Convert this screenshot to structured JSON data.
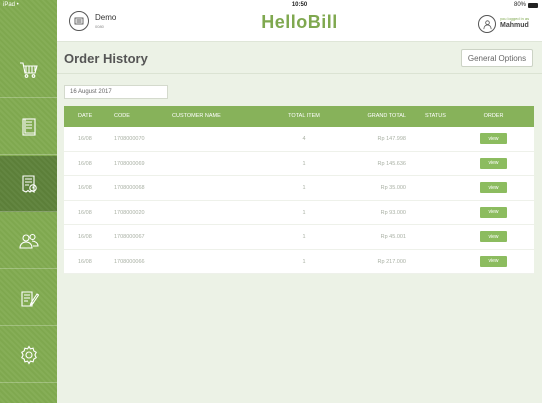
{
  "status_bar": {
    "device": "iPad •",
    "time": "10:50",
    "battery": "80%"
  },
  "header": {
    "store_name": "Demo",
    "store_sub": "0080",
    "brand": "HelloBill",
    "user_note": "you logged in as",
    "user_name": "Mahmud"
  },
  "sidebar": {
    "items": [
      {
        "icon": "cart-icon",
        "active": false
      },
      {
        "icon": "document-icon",
        "active": false
      },
      {
        "icon": "receipt-icon",
        "active": true
      },
      {
        "icon": "users-icon",
        "active": false
      },
      {
        "icon": "edit-report-icon",
        "active": false
      },
      {
        "icon": "settings-icon",
        "active": false
      }
    ]
  },
  "page": {
    "title": "Order History",
    "general_options": "General Options",
    "date_filter": "16 August 2017"
  },
  "table": {
    "columns": [
      "DATE",
      "CODE",
      "CUSTOMER NAME",
      "TOTAL ITEM",
      "GRAND TOTAL",
      "STATUS",
      "ORDER"
    ],
    "rows": [
      {
        "date": "16/08",
        "code": "1708000070",
        "customer": "",
        "total_item": "4",
        "grand_total": "Rp 147.998",
        "status": "",
        "order": "view"
      },
      {
        "date": "16/08",
        "code": "1708000069",
        "customer": "",
        "total_item": "1",
        "grand_total": "Rp 145.636",
        "status": "",
        "order": "view"
      },
      {
        "date": "16/08",
        "code": "1708000068",
        "customer": "",
        "total_item": "1",
        "grand_total": "Rp 35.000",
        "status": "",
        "order": "view"
      },
      {
        "date": "16/08",
        "code": "1708000020",
        "customer": "",
        "total_item": "1",
        "grand_total": "Rp 93.000",
        "status": "",
        "order": "view"
      },
      {
        "date": "16/08",
        "code": "1708000067",
        "customer": "",
        "total_item": "1",
        "grand_total": "Rp 45.001",
        "status": "",
        "order": "view"
      },
      {
        "date": "16/08",
        "code": "1708000066",
        "customer": "",
        "total_item": "1",
        "grand_total": "Rp 217.000",
        "status": "",
        "order": "view"
      }
    ]
  },
  "colors": {
    "accent": "#7fa84f",
    "table_header": "#87b25a",
    "view_button": "#8cbc5f",
    "background": "#ecf2e6"
  }
}
